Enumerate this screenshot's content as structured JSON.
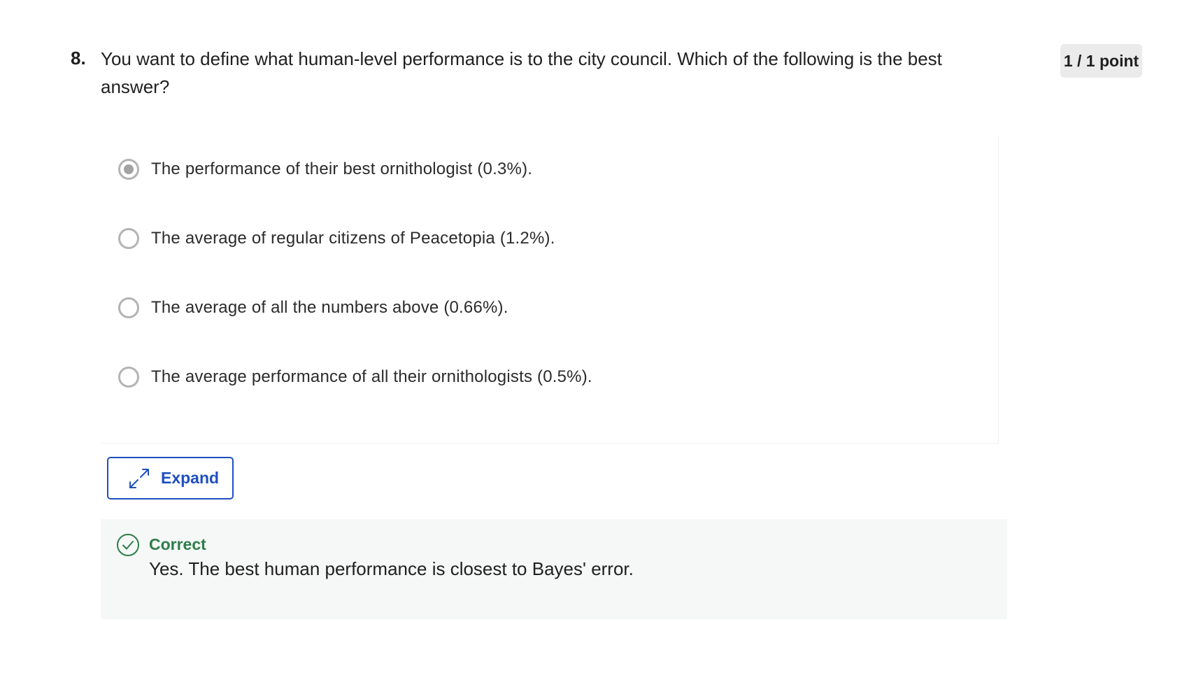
{
  "question": {
    "number": "8.",
    "text": "You want to define what human-level performance is to the city council. Which of the following is the best answer?",
    "points": "1 / 1 point"
  },
  "options": [
    {
      "label": "The performance of their best ornithologist (0.3%).",
      "selected": true
    },
    {
      "label": "The average of regular citizens of Peacetopia (1.2%).",
      "selected": false
    },
    {
      "label": "The average of all the numbers above (0.66%).",
      "selected": false
    },
    {
      "label": "The average performance of all their ornithologists (0.5%).",
      "selected": false
    }
  ],
  "expand": {
    "label": "Expand",
    "icon": "expand-arrows-icon"
  },
  "feedback": {
    "icon": "check-circle-icon",
    "title": "Correct",
    "text": "Yes. The best human performance is closest to Bayes' error."
  },
  "colors": {
    "accent": "#1f4fbf",
    "success": "#2e7d4a",
    "feedback_bg": "#f5f8f6",
    "badge_bg": "#ebebeb",
    "radio_border": "#b3b3b3"
  }
}
